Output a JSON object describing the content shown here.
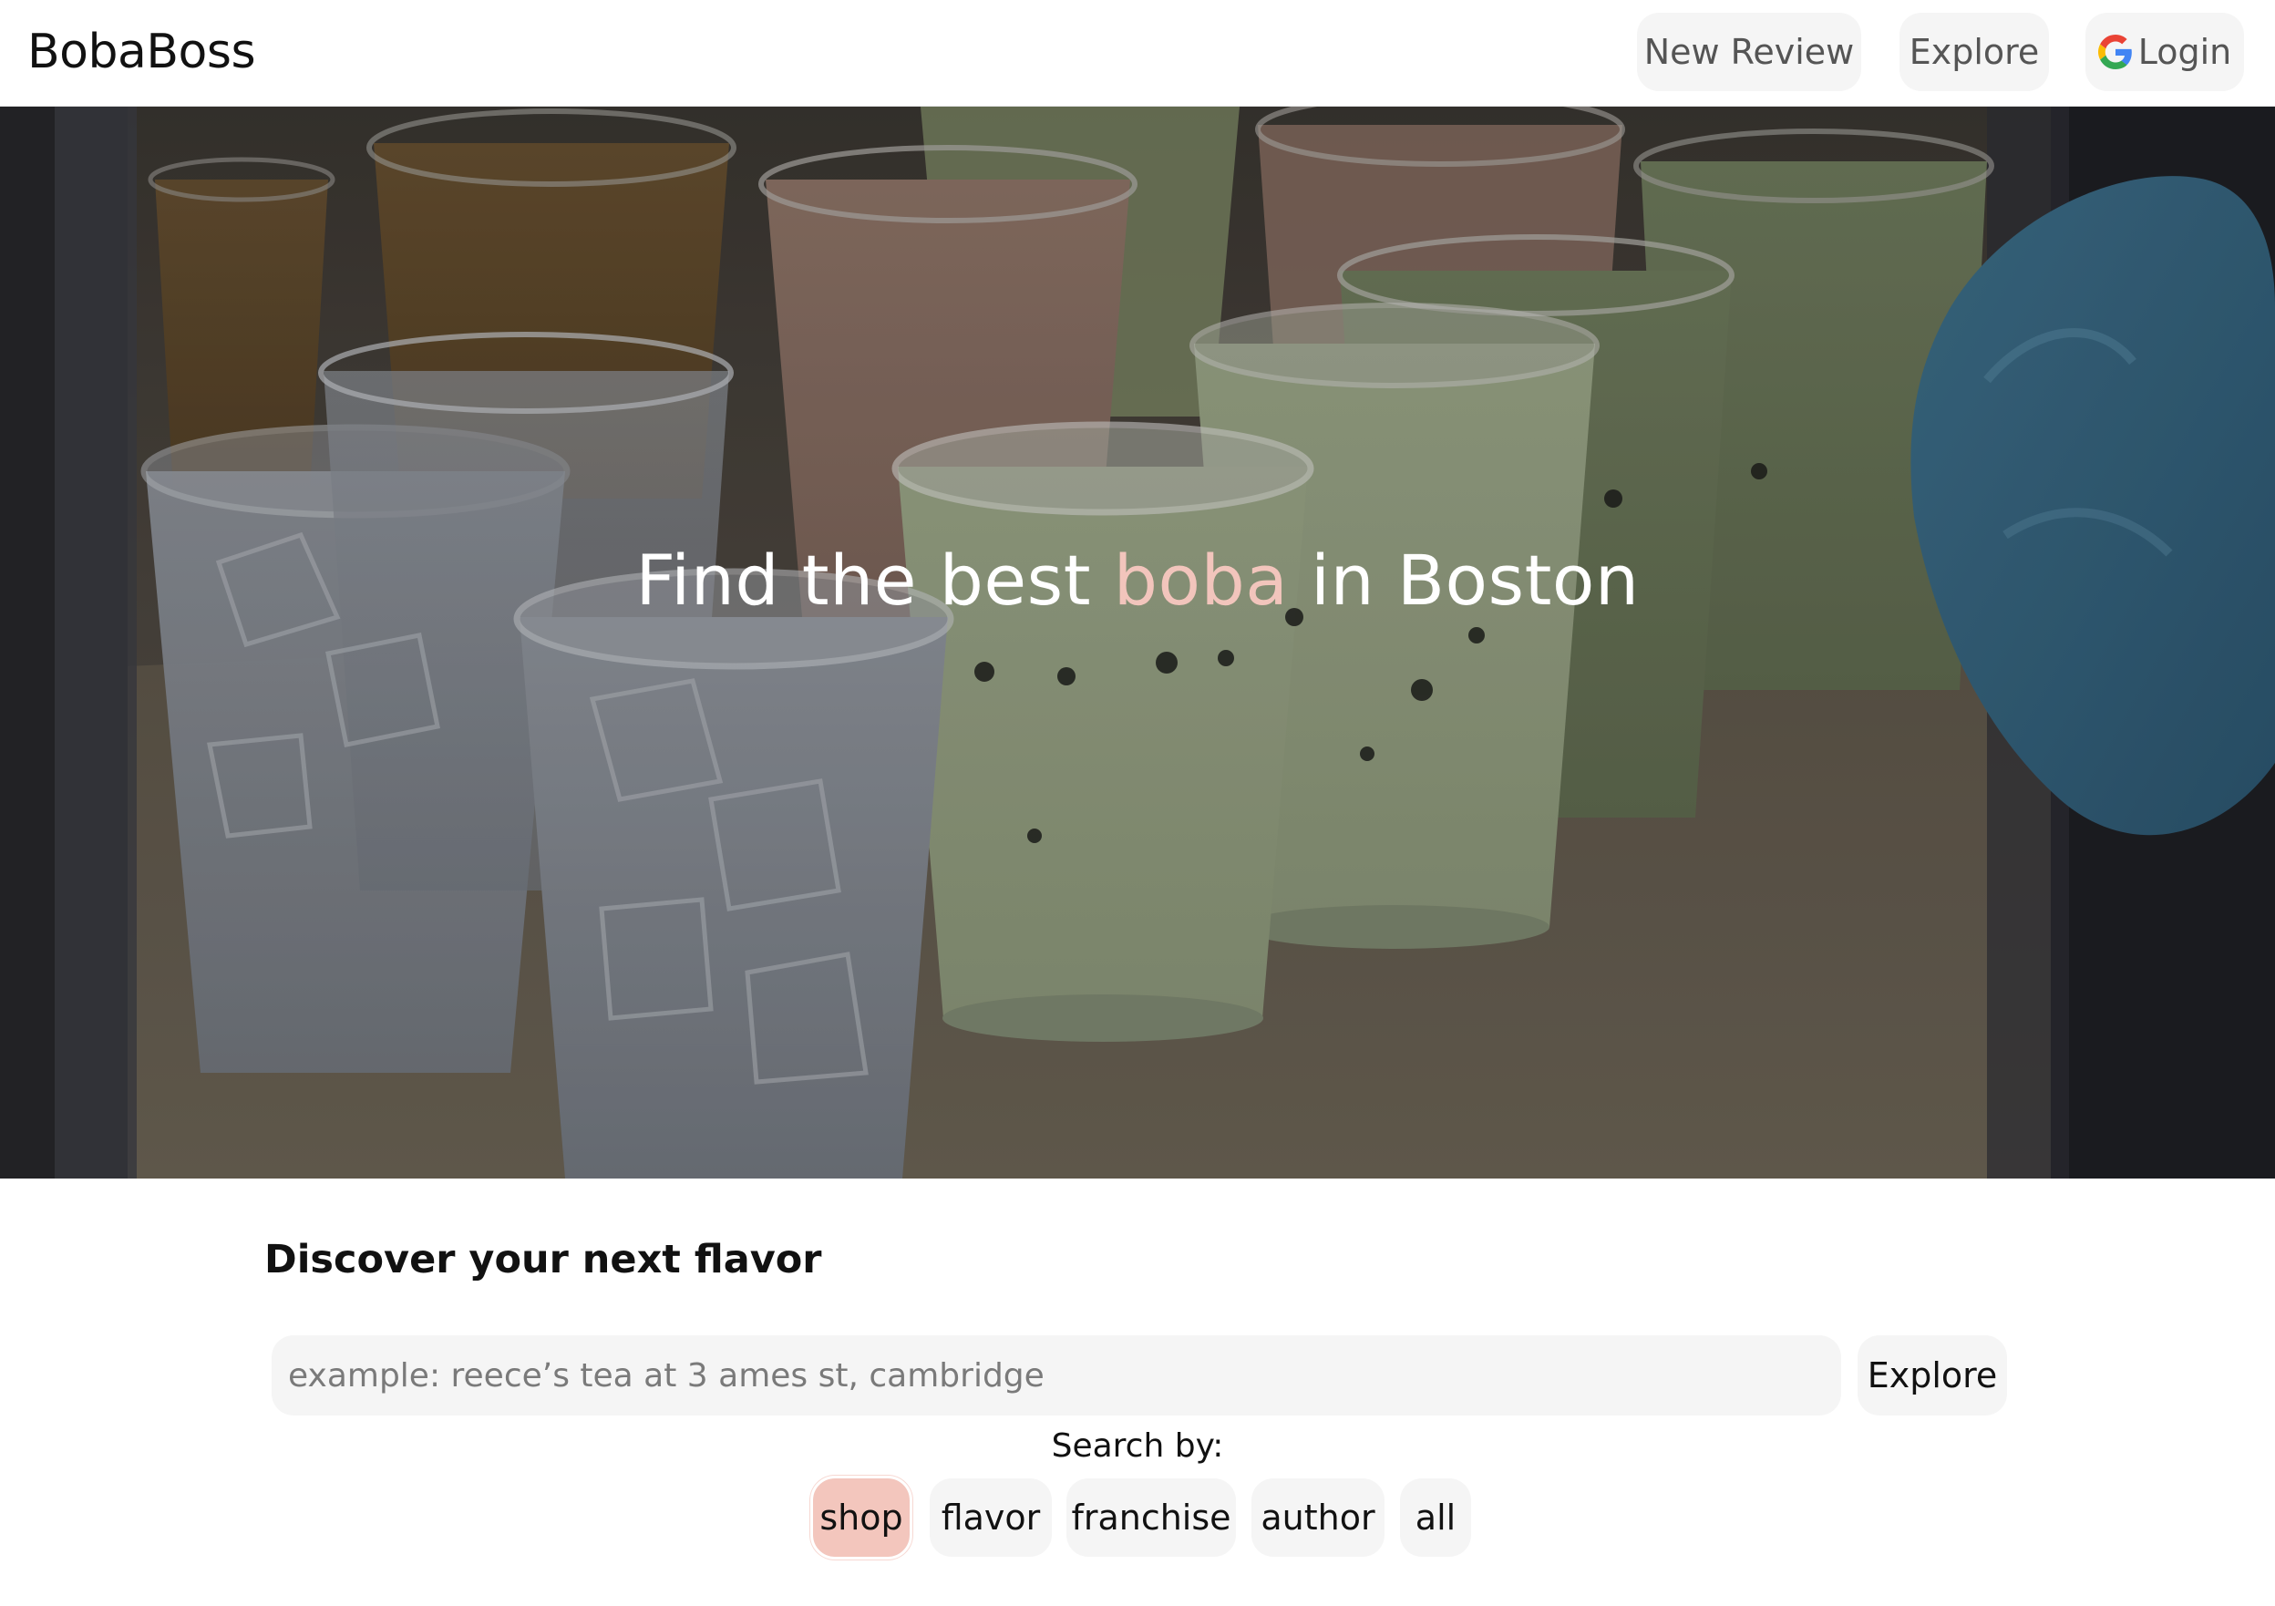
{
  "header": {
    "brand": "BobaBoss",
    "nav": {
      "new_review": "New Review",
      "explore": "Explore",
      "login": "Login"
    }
  },
  "hero": {
    "title_before": "Find the best ",
    "title_accent": "boba",
    "title_after": " in Boston",
    "accent_color": "#f2c5bc"
  },
  "discover": {
    "heading": "Discover your next flavor",
    "search": {
      "placeholder": "example: reece’s tea at 3 ames st, cambridge",
      "value": ""
    },
    "explore_label": "Explore",
    "search_by_label": "Search by:",
    "filters": [
      {
        "label": "shop",
        "selected": true
      },
      {
        "label": "flavor",
        "selected": false
      },
      {
        "label": "franchise",
        "selected": false
      },
      {
        "label": "author",
        "selected": false
      },
      {
        "label": "all",
        "selected": false
      }
    ],
    "selected_color": "#f3c6bd"
  }
}
